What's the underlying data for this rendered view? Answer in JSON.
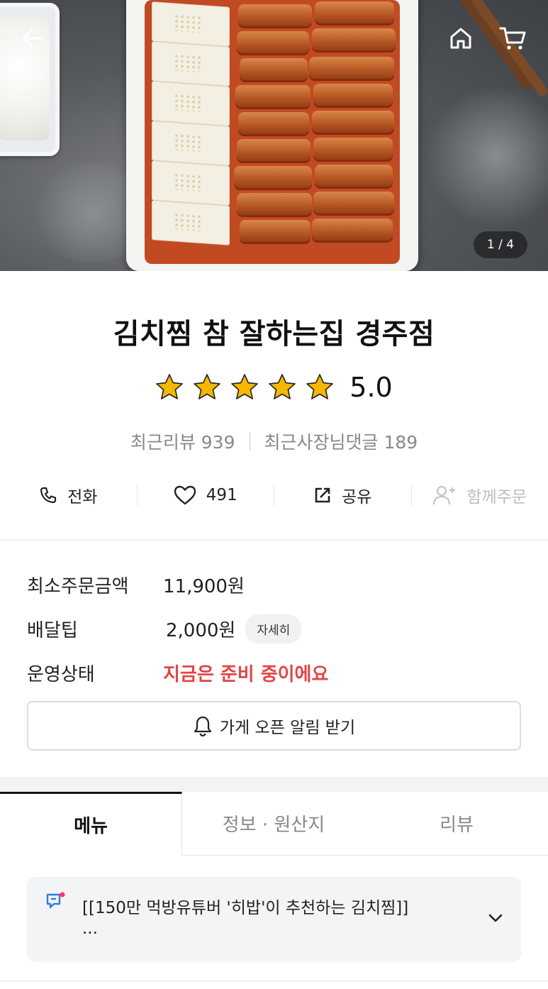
{
  "hero": {
    "page_indicator": "1 / 4",
    "icons": [
      "back-arrow-icon",
      "home-icon",
      "cart-icon"
    ]
  },
  "store": {
    "name": "김치찜 참 잘하는집 경주점",
    "rating": 5.0,
    "rating_text": "5.0",
    "stars_filled": 5,
    "stars_total": 5,
    "recent_reviews": "최근리뷰 939",
    "owner_replies": "최근사장님댓글 189"
  },
  "actions": {
    "call": "전화",
    "like_count": "491",
    "share": "공유",
    "group_order": "함께주문"
  },
  "info": {
    "min_order_label": "최소주문금액",
    "min_order_value": "11,900원",
    "delivery_tip_label": "배달팁",
    "delivery_tip_value": "2,000원",
    "detail_badge": "자세히",
    "status_label": "운영상태",
    "status_value": "지금은 준비 중이에요"
  },
  "notify_button": "가게 오픈 알림 받기",
  "tabs": [
    {
      "label": "메뉴",
      "active": true
    },
    {
      "label": "정보 · 원산지",
      "active": false
    },
    {
      "label": "리뷰",
      "active": false
    }
  ],
  "notice": {
    "text_line1": "[[150만 먹방유튜버 '히밥'이 추천하는 김치찜]]",
    "text_line2": "..."
  },
  "colors": {
    "status_red": "#e34444",
    "star_gold": "#f5b800",
    "notice_blue": "#2f7de1",
    "notice_dot": "#ff3b6b"
  }
}
